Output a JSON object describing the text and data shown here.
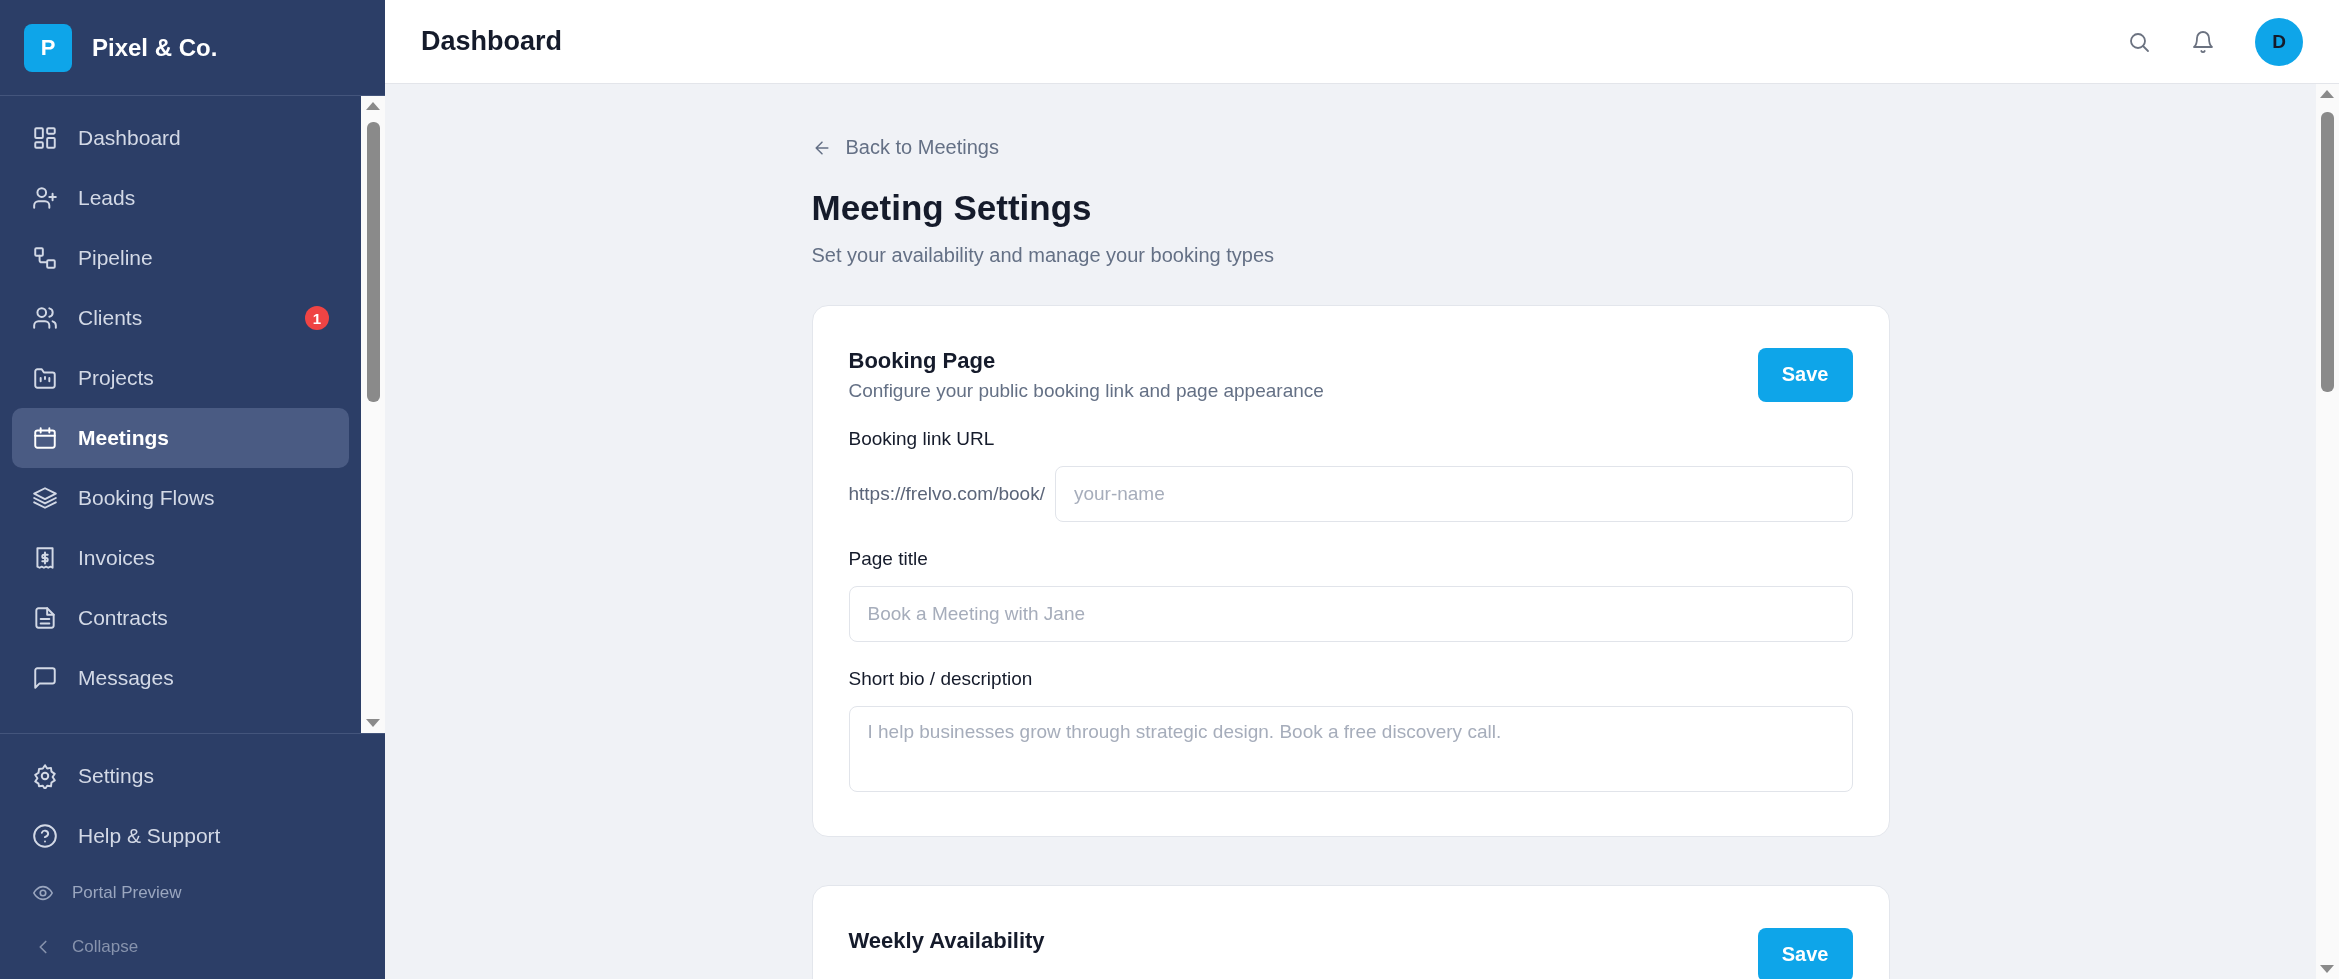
{
  "brand": {
    "initial": "P",
    "name": "Pixel & Co."
  },
  "sidebar": {
    "items": [
      {
        "label": "Dashboard",
        "selected": false
      },
      {
        "label": "Leads",
        "selected": false
      },
      {
        "label": "Pipeline",
        "selected": false
      },
      {
        "label": "Clients",
        "selected": false,
        "badge": "1"
      },
      {
        "label": "Projects",
        "selected": false
      },
      {
        "label": "Meetings",
        "selected": true
      },
      {
        "label": "Booking Flows",
        "selected": false
      },
      {
        "label": "Invoices",
        "selected": false
      },
      {
        "label": "Contracts",
        "selected": false
      },
      {
        "label": "Messages",
        "selected": false
      }
    ],
    "footer_items": [
      {
        "label": "Settings"
      },
      {
        "label": "Help & Support"
      }
    ],
    "portal_preview": "Portal Preview",
    "collapse": "Collapse"
  },
  "header": {
    "title": "Dashboard",
    "avatar": "D"
  },
  "page": {
    "back_link": "Back to Meetings",
    "title": "Meeting Settings",
    "subtitle": "Set your availability and manage your booking types"
  },
  "cards": [
    {
      "title": "Booking Page",
      "subtitle": "Configure your public booking link and page appearance",
      "button": "Save",
      "fields": [
        {
          "kind": "prefixed",
          "label": "Booking link URL",
          "prefix": "https://frelvo.com/book/",
          "placeholder": "your-name"
        },
        {
          "kind": "text",
          "label": "Page title",
          "placeholder": "Book a Meeting with Jane"
        },
        {
          "kind": "textarea",
          "label": "Short bio / description",
          "placeholder": "I help businesses grow through strategic design. Book a free discovery call."
        }
      ]
    },
    {
      "title": "Weekly Availability",
      "button": "Save"
    }
  ]
}
